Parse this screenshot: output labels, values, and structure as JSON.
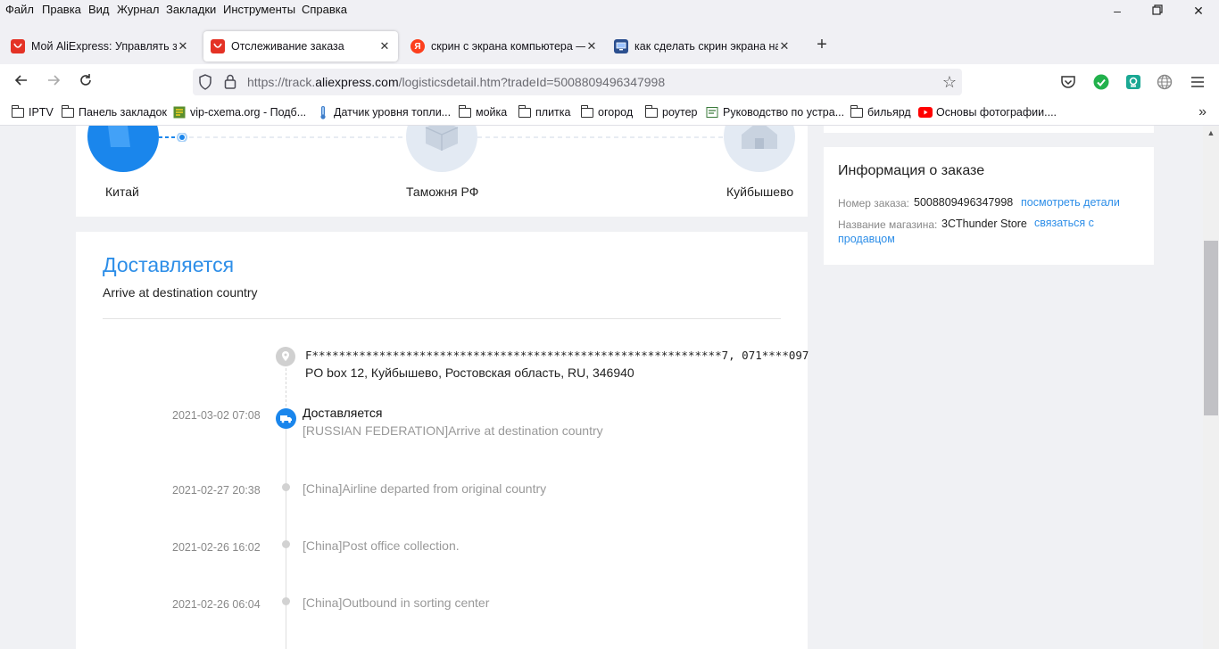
{
  "menu": [
    "Файл",
    "Правка",
    "Вид",
    "Журнал",
    "Закладки",
    "Инструменты",
    "Справка"
  ],
  "tabs": [
    {
      "title": "Мой AliExpress: Управлять зака",
      "favicon": "aliexpress-icon"
    },
    {
      "title": "Отслеживание заказа",
      "favicon": "aliexpress-icon"
    },
    {
      "title": "скрин с экрана компьютера —",
      "favicon": "yandex-icon"
    },
    {
      "title": "как сделать скрин экрана на к",
      "favicon": "monitor-icon"
    }
  ],
  "url": {
    "prefix": "https://track.",
    "host": "aliexpress.com",
    "path": "/logisticsdetail.htm?tradeId=5008809496347998"
  },
  "bookmarks": [
    {
      "label": "IPTV",
      "icon": "folder-icon"
    },
    {
      "label": "Панель закладок",
      "icon": "folder-icon"
    },
    {
      "label": "vip-cxema.org - Подб...",
      "icon": "site-icon"
    },
    {
      "label": "Датчик уровня топли...",
      "icon": "thermometer-icon"
    },
    {
      "label": "мойка",
      "icon": "folder-icon"
    },
    {
      "label": "плитка",
      "icon": "folder-icon"
    },
    {
      "label": "огород",
      "icon": "folder-icon"
    },
    {
      "label": "роутер",
      "icon": "folder-icon"
    },
    {
      "label": "Руководство по устра...",
      "icon": "site-icon"
    },
    {
      "label": "бильярд",
      "icon": "folder-icon"
    },
    {
      "label": "Основы фотографии....",
      "icon": "youtube-icon"
    }
  ],
  "route": {
    "origin": "Китай",
    "customs": "Таможня РФ",
    "destination": "Куйбышево"
  },
  "status": {
    "title": "Доставляется",
    "subtitle": "Arrive at destination country"
  },
  "address": {
    "line1": "F*************************************************************7, 071****097",
    "line2": "PO box 12, Куйбышево, Ростовская область, RU, 346940"
  },
  "events": [
    {
      "date": "2021-03-02 07:08",
      "title": "Доставляется",
      "text": "[RUSSIAN FEDERATION]Arrive at destination country"
    },
    {
      "date": "2021-02-27 20:38",
      "text": "[China]Airline departed from original country"
    },
    {
      "date": "2021-02-26 16:02",
      "text": "[China]Post office collection."
    },
    {
      "date": "2021-02-26 06:04",
      "text": "[China]Outbound in sorting center"
    }
  ],
  "order_info": {
    "title": "Информация о заказе",
    "order_label": "Номер заказа:",
    "order_number": "5008809496347998",
    "details_link": "посмотреть детали",
    "store_label": "Название магазина:",
    "store_name": "3CThunder Store",
    "contact_link_1": "связаться с",
    "contact_link_2": "продавцом"
  },
  "colors": {
    "accent": "#2d8ee8",
    "aliexpress": "#e43225"
  }
}
